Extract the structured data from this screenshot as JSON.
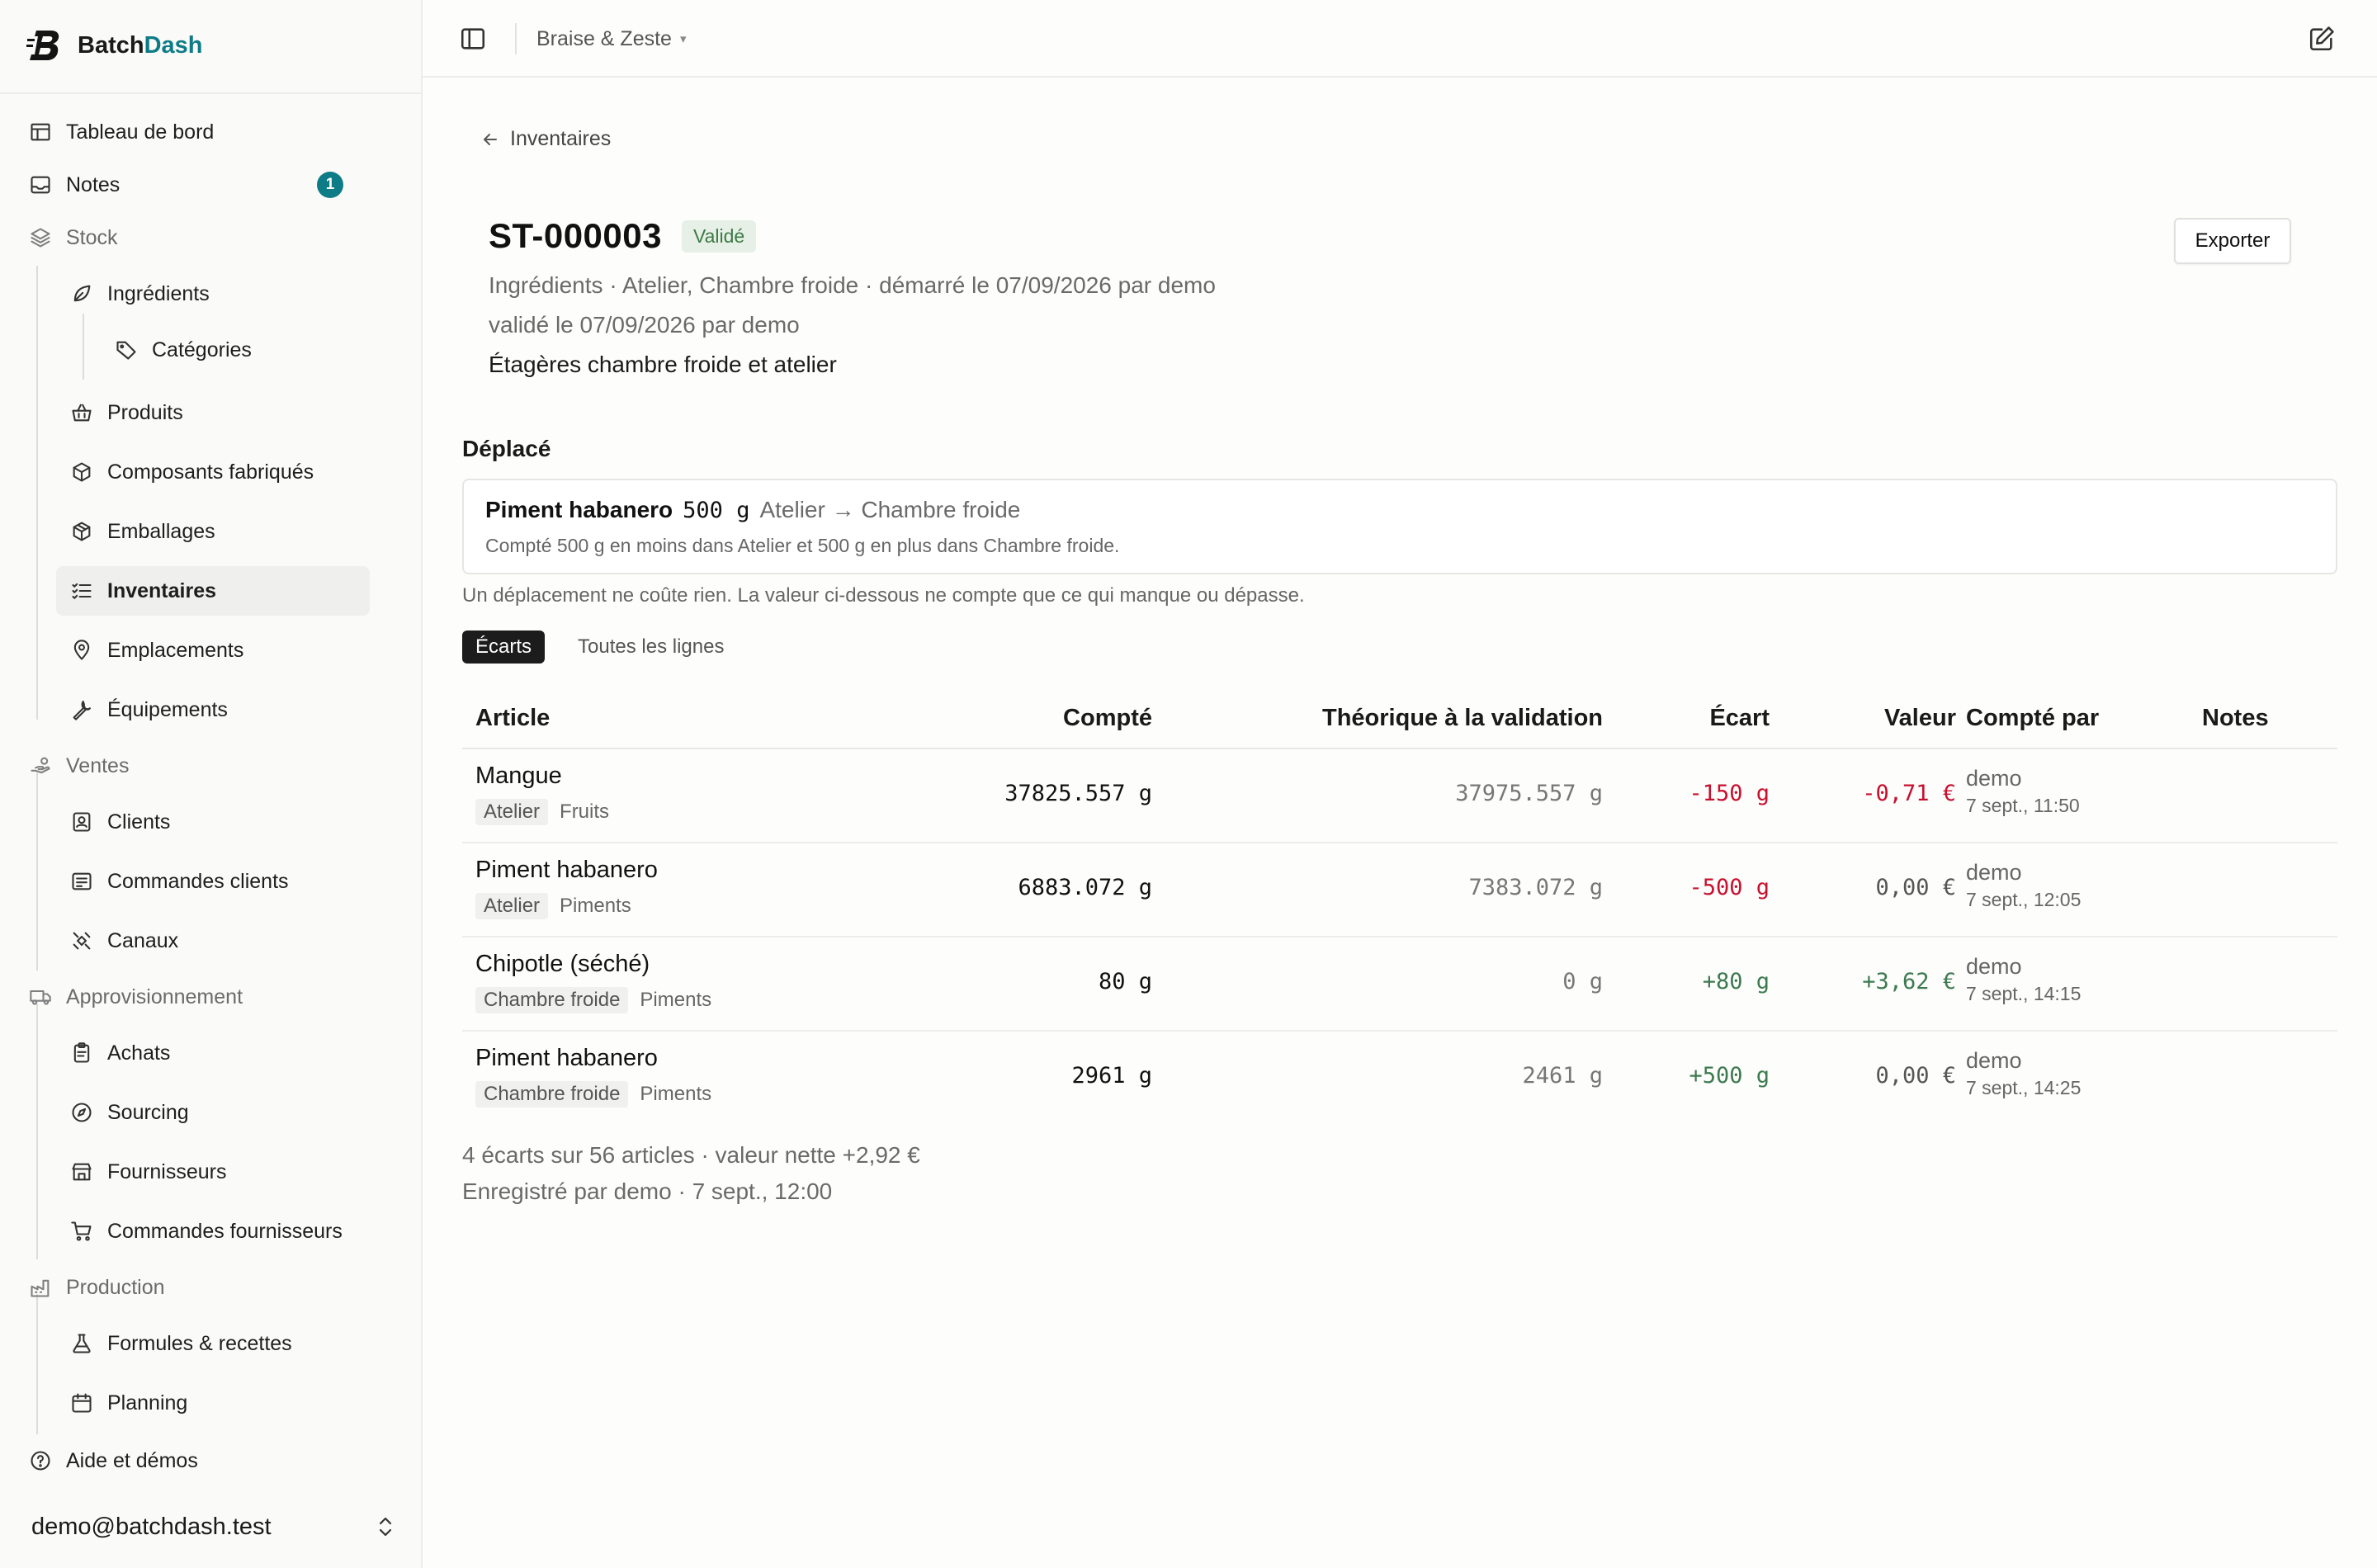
{
  "brand": {
    "name_a": "Batch",
    "name_b": "Dash",
    "accent": "#0e7c86"
  },
  "sidebar": {
    "items": [
      {
        "label": "Tableau de bord",
        "icon": "layout-icon"
      },
      {
        "label": "Notes",
        "icon": "inbox-icon",
        "badge": "1"
      },
      {
        "label": "Stock",
        "icon": "layers-icon"
      },
      {
        "label": "Ingrédients",
        "icon": "leaf-icon"
      },
      {
        "label": "Catégories",
        "icon": "tag-icon"
      },
      {
        "label": "Produits",
        "icon": "basket-icon"
      },
      {
        "label": "Composants fabriqués",
        "icon": "box-icon"
      },
      {
        "label": "Emballages",
        "icon": "package-icon"
      },
      {
        "label": "Inventaires",
        "icon": "list-check-icon"
      },
      {
        "label": "Emplacements",
        "icon": "map-pin-icon"
      },
      {
        "label": "Équipements",
        "icon": "wrench-icon"
      },
      {
        "label": "Ventes",
        "icon": "hand-coins-icon"
      },
      {
        "label": "Clients",
        "icon": "contact-icon"
      },
      {
        "label": "Commandes clients",
        "icon": "receipt-icon"
      },
      {
        "label": "Canaux",
        "icon": "satellite-icon"
      },
      {
        "label": "Approvisionnement",
        "icon": "truck-icon"
      },
      {
        "label": "Achats",
        "icon": "clipboard-icon"
      },
      {
        "label": "Sourcing",
        "icon": "compass-icon"
      },
      {
        "label": "Fournisseurs",
        "icon": "store-icon"
      },
      {
        "label": "Commandes fournisseurs",
        "icon": "cart-icon"
      },
      {
        "label": "Production",
        "icon": "factory-icon"
      },
      {
        "label": "Formules & recettes",
        "icon": "flask-icon"
      },
      {
        "label": "Planning",
        "icon": "calendar-icon"
      },
      {
        "label": "Aide et démos",
        "icon": "help-icon"
      }
    ],
    "user": "demo@batchdash.test"
  },
  "topbar": {
    "workspace": "Braise & Zeste",
    "caret": "▾"
  },
  "page": {
    "back": "Inventaires",
    "title": "ST-000003",
    "status": "Validé",
    "export": "Exporter",
    "meta1": "Ingrédients · Atelier, Chambre froide · démarré le 07/09/2026 par demo",
    "meta2": "validé le 07/09/2026 par demo",
    "meta3": "Étagères chambre froide et atelier"
  },
  "moved": {
    "heading": "Déplacé",
    "name": "Piment habanero",
    "qty": "500 g",
    "route": "Atelier → Chambre froide",
    "detail": "Compté 500 g en moins dans Atelier et 500 g en plus dans Chambre froide.",
    "note": "Un déplacement ne coûte rien. La valeur ci-dessous ne compte que ce qui manque ou dépasse."
  },
  "tabs": {
    "ecarts": "Écarts",
    "all": "Toutes les lignes"
  },
  "table": {
    "headers": {
      "article": "Article",
      "compte": "Compté",
      "theo": "Théorique à la validation",
      "ecart": "Écart",
      "valeur": "Valeur",
      "by": "Compté par",
      "notes": "Notes"
    },
    "rows": [
      {
        "name": "Mangue",
        "loc": "Atelier",
        "cat": "Fruits",
        "compte": "37825.557 g",
        "theo": "37975.557 g",
        "ecart": "-150 g",
        "valeur": "-0,71 €",
        "who": "demo",
        "when": "7 sept., 11:50"
      },
      {
        "name": "Piment habanero",
        "loc": "Atelier",
        "cat": "Piments",
        "compte": "6883.072 g",
        "theo": "7383.072 g",
        "ecart": "-500 g",
        "valeur": "0,00 €",
        "who": "demo",
        "when": "7 sept., 12:05"
      },
      {
        "name": "Chipotle (séché)",
        "loc": "Chambre froide",
        "cat": "Piments",
        "compte": "80 g",
        "theo": "0 g",
        "ecart": "+80 g",
        "valeur": "+3,62 €",
        "who": "demo",
        "when": "7 sept., 14:15"
      },
      {
        "name": "Piment habanero",
        "loc": "Chambre froide",
        "cat": "Piments",
        "compte": "2961 g",
        "theo": "2461 g",
        "ecart": "+500 g",
        "valeur": "0,00 €",
        "who": "demo",
        "when": "7 sept., 14:25"
      }
    ]
  },
  "summary": {
    "line1": "4 écarts sur 56 articles · valeur nette +2,92 €",
    "line2": "Enregistré par demo · 7 sept., 12:00"
  }
}
